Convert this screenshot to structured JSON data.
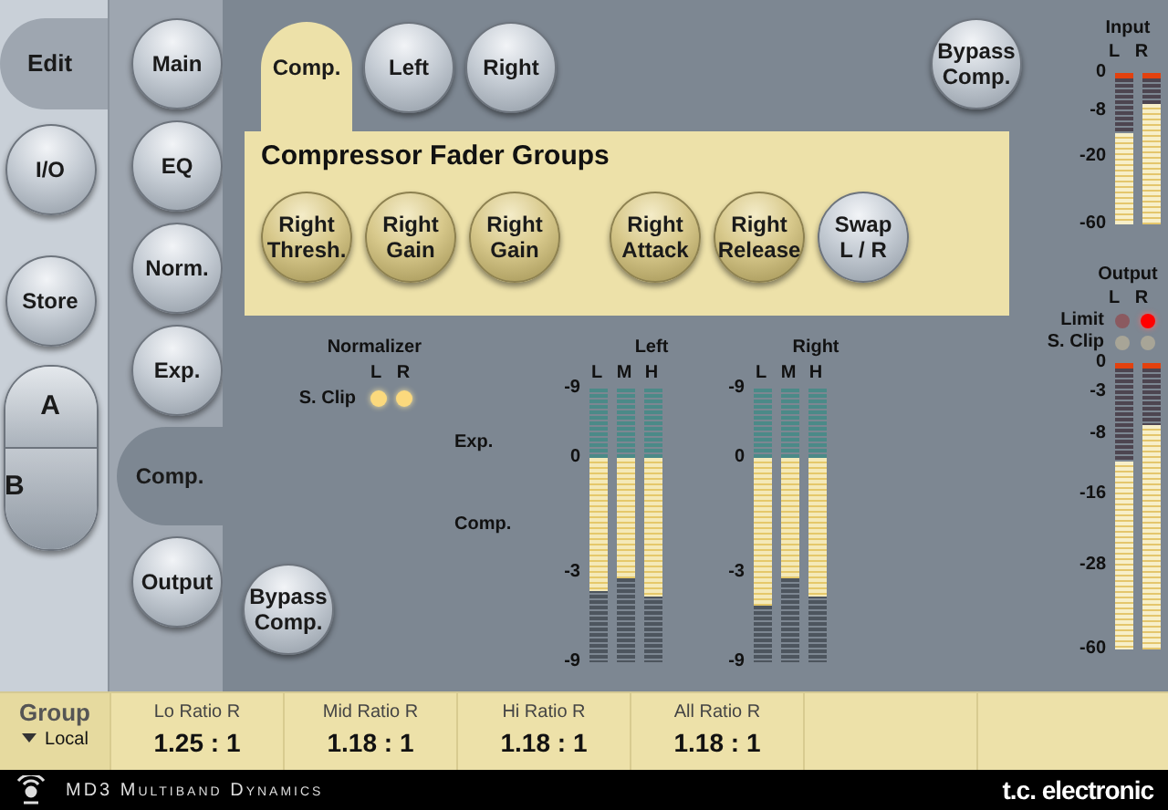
{
  "side_menu": [
    {
      "label": "Edit",
      "selected": true
    },
    {
      "label": "I/O",
      "selected": false
    },
    {
      "label": "Store",
      "selected": false
    }
  ],
  "ab_buttons": [
    {
      "label": "A"
    },
    {
      "label": "B"
    }
  ],
  "pages": [
    {
      "label": "Main",
      "selected": false
    },
    {
      "label": "EQ",
      "selected": false
    },
    {
      "label": "Norm.",
      "selected": false
    },
    {
      "label": "Exp.",
      "selected": false
    },
    {
      "label": "Comp.",
      "selected": true
    },
    {
      "label": "Output",
      "selected": false
    }
  ],
  "tabs": [
    {
      "label": "Comp.",
      "selected": true
    },
    {
      "label": "Left",
      "selected": false
    },
    {
      "label": "Right",
      "selected": false
    }
  ],
  "bypass_top": "Bypass\nComp.",
  "panel": {
    "title": "Compressor Fader Groups",
    "buttons": [
      {
        "label": "Right\nThresh.",
        "kind": "gold"
      },
      {
        "label": "Right\nGain",
        "kind": "gold"
      },
      {
        "label": "Right\nGain",
        "kind": "gold"
      },
      {
        "label": "Right\nAttack",
        "kind": "gold"
      },
      {
        "label": "Right\nRelease",
        "kind": "gold"
      },
      {
        "label": "Swap\nL / R",
        "kind": "silver"
      }
    ]
  },
  "normalizer": {
    "title": "Normalizer",
    "channels": [
      "L",
      "R"
    ],
    "row_label": "S. Clip",
    "leds": [
      {
        "on": true
      },
      {
        "on": true
      }
    ]
  },
  "bypass_bottom": "Bypass\nComp.",
  "zone_labels": [
    "Exp.",
    "Comp."
  ],
  "gain_meters": [
    {
      "title": "Left",
      "scale": [
        "-9",
        "0",
        "-3",
        "-9"
      ],
      "bands": [
        {
          "label": "L",
          "level": 0.65
        },
        {
          "label": "M",
          "level": 0.59
        },
        {
          "label": "H",
          "level": 0.68
        }
      ]
    },
    {
      "title": "Right",
      "scale": [
        "-9",
        "0",
        "-3",
        "-9"
      ],
      "bands": [
        {
          "label": "L",
          "level": 0.72
        },
        {
          "label": "M",
          "level": 0.59
        },
        {
          "label": "H",
          "level": 0.68
        }
      ]
    }
  ],
  "input_meter": {
    "title": "Input",
    "scale": [
      "0",
      "-8",
      "-20",
      "-60"
    ],
    "channels": [
      {
        "label": "L",
        "level": 0.63
      },
      {
        "label": "R",
        "level": 0.82
      }
    ]
  },
  "output_meter": {
    "title": "Output",
    "indicators": [
      {
        "label": "Limit",
        "leds": [
          {
            "on": false
          },
          {
            "on": true
          }
        ]
      },
      {
        "label": "S. Clip",
        "leds": [
          {
            "on": false
          },
          {
            "on": false
          }
        ]
      }
    ],
    "scale": [
      "0",
      "-3",
      "-8",
      "-16",
      "-28",
      "-60"
    ],
    "channels": [
      {
        "label": "L",
        "level": 0.67
      },
      {
        "label": "R",
        "level": 0.8
      }
    ]
  },
  "group": {
    "title": "Group",
    "value": "Local"
  },
  "parameters": [
    {
      "label": "Lo Ratio R",
      "value": "1.25 : 1"
    },
    {
      "label": "Mid Ratio R",
      "value": "1.18 : 1"
    },
    {
      "label": "Hi Ratio R",
      "value": "1.18 : 1"
    },
    {
      "label": "All Ratio R",
      "value": "1.18 : 1"
    }
  ],
  "footer": {
    "product": "MD3 Multiband Dynamics",
    "brand": "t.c. electronic"
  }
}
